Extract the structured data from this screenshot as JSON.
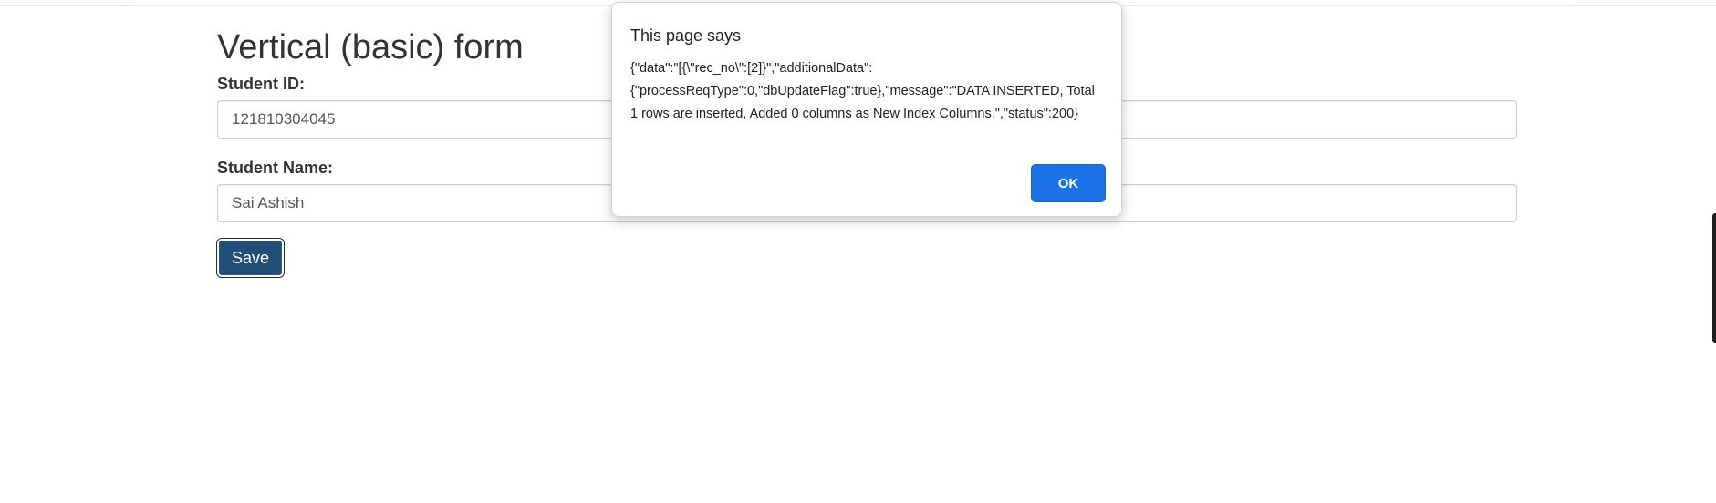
{
  "form": {
    "title": "Vertical (basic) form",
    "student_id_label": "Student ID:",
    "student_id_value": "121810304045",
    "student_name_label": "Student Name:",
    "student_name_value": "Sai Ashish",
    "save_label": "Save"
  },
  "dialog": {
    "title": "This page says",
    "message": "{\"data\":\"[{\\\"rec_no\\\":[2]}\",\"additionalData\":{\"processReqType\":0,\"dbUpdateFlag\":true},\"message\":\"DATA INSERTED, Total 1 rows are inserted, Added 0 columns as New Index Columns.\",\"status\":200}",
    "ok_label": "OK"
  },
  "colors": {
    "save_button": "#1f4e79",
    "ok_button": "#1a73e8"
  }
}
